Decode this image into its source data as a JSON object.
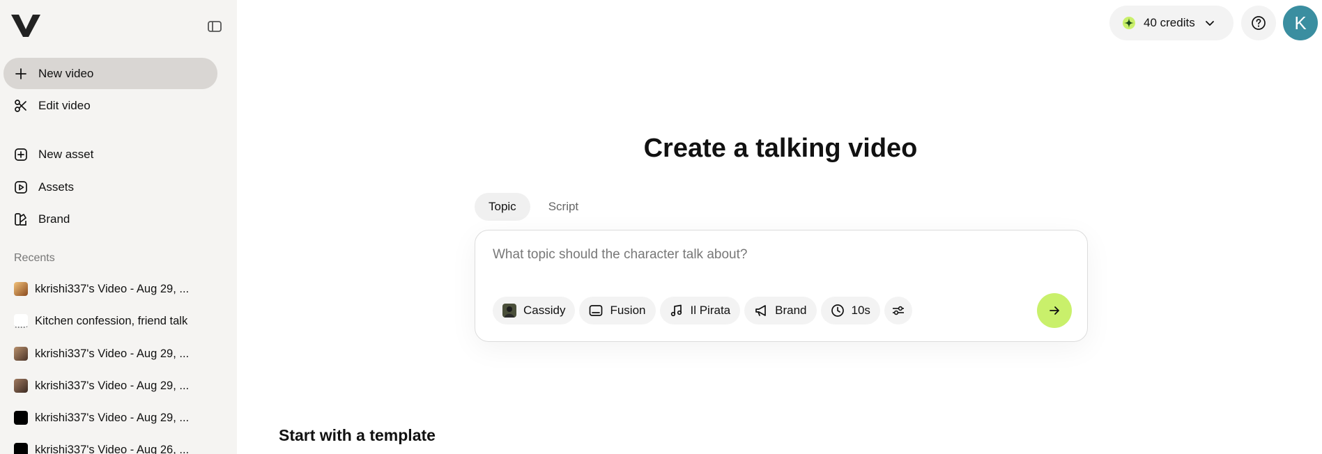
{
  "sidebar": {
    "nav": [
      {
        "label": "New video",
        "icon": "plus-icon"
      },
      {
        "label": "Edit video",
        "icon": "scissors-icon"
      },
      {
        "label": "New asset",
        "icon": "plus-square-icon"
      },
      {
        "label": "Assets",
        "icon": "play-square-icon"
      },
      {
        "label": "Brand",
        "icon": "palette-icon"
      }
    ],
    "recents_title": "Recents",
    "recents": [
      {
        "label": "kkrishi337's Video - Aug 29, ...",
        "thumb": "#c98a4a"
      },
      {
        "label": "Kitchen confession, friend talk",
        "thumb": "#ffffff"
      },
      {
        "label": "kkrishi337's Video - Aug 29, ...",
        "thumb": "#8a6a55"
      },
      {
        "label": "kkrishi337's Video - Aug 29, ...",
        "thumb": "#6e5548"
      },
      {
        "label": "kkrishi337's Video - Aug 29, ...",
        "thumb": "#000000"
      },
      {
        "label": "kkrishi337's Video - Aug 26, ...",
        "thumb": "#000000"
      }
    ]
  },
  "topbar": {
    "credits_label": "40 credits",
    "avatar_letter": "K"
  },
  "main": {
    "title": "Create a talking video",
    "tabs": [
      {
        "label": "Topic",
        "active": true
      },
      {
        "label": "Script",
        "active": false
      }
    ],
    "prompt_placeholder": "What topic should the character talk about?",
    "chips": [
      {
        "label": "Cassidy",
        "icon": "avatar-thumb-icon"
      },
      {
        "label": "Fusion",
        "icon": "display-icon"
      },
      {
        "label": "Il Pirata",
        "icon": "music-note-icon"
      },
      {
        "label": "Brand",
        "icon": "megaphone-icon"
      },
      {
        "label": "10s",
        "icon": "clock-icon"
      }
    ],
    "section_title": "Start with a template"
  },
  "colors": {
    "accent": "#c9f06b",
    "sidebar_bg": "#f5f4f2",
    "avatar_bg": "#3a8ea0"
  }
}
